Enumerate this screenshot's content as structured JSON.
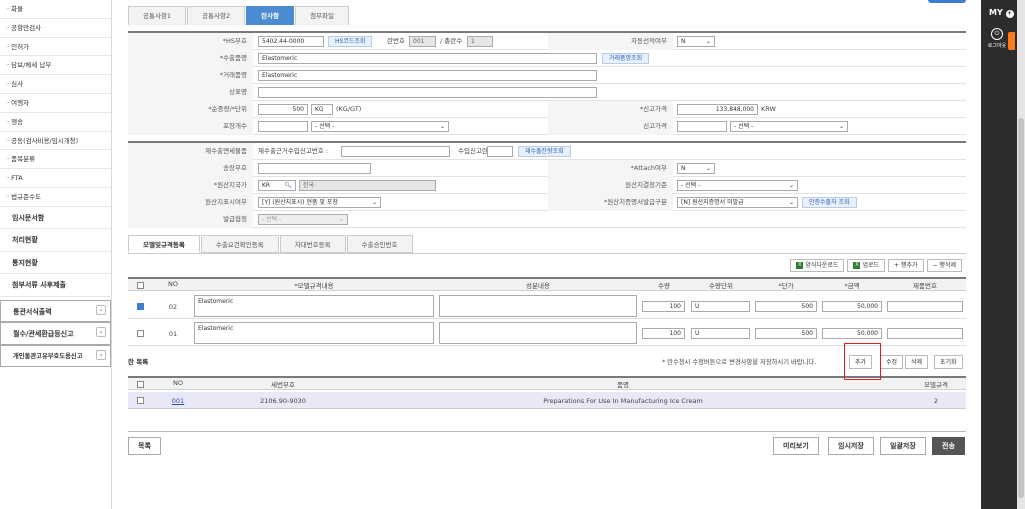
{
  "sidebar": {
    "items": [
      "화물",
      "공항만검사",
      "인허가",
      "담보/체세 납부",
      "심사",
      "여행자",
      "쟁송",
      "공동(검사비용/임시개청)",
      "품목분류",
      "FTA",
      "법규준수도"
    ],
    "top_items": [
      "임시문서함",
      "처리현황",
      "통지현황",
      "첨부서류 사후제출"
    ],
    "select_items": [
      "통관서식출력",
      "월수/관세환급등신고",
      "개인통관고유부호도용신고"
    ]
  },
  "tabs": [
    "공통사항1",
    "공통사항2",
    "란사항",
    "첨부파일"
  ],
  "form": {
    "hs_label": "*HS부호",
    "hs_value": "5402.44-0000",
    "hs_lookup": "HS코드조회",
    "ran_label": "란번호",
    "ran_value": "001",
    "total_ran_label": "/ 총란수",
    "total_ran_value": "1",
    "auto_sel_label": "자동선적여부",
    "auto_sel_value": "N",
    "export_name_label": "*수출품명",
    "export_name_value": "Elastomeric",
    "trade_lookup": "거래품명조회",
    "trade_name_label": "*거래품명",
    "trade_name_value": "Elastomeric",
    "brand_label": "상표명",
    "brand_value": "",
    "weight_label": "*순중량/*단위",
    "weight_value": "500",
    "weight_unit": "KG",
    "weight_unit_text": "(KG/GT)",
    "declared_price_label": "*신고가격",
    "declared_price_value": "133,848,000",
    "currency": "KRW",
    "pack_label": "포장개수",
    "pack_select": "- 선택 -",
    "declared_amount_label": "신고가격",
    "declared_amount_select": "- 선택 -",
    "reexport_label": "재수출면세물품",
    "reexport_text": "재수출근거수입신고번호 :",
    "import_num_text": "수입신고란번호 :",
    "reexport_lookup": "재수출잔량조회",
    "song_label": "송장부호",
    "attach_label": "*Attach여부",
    "attach_value": "N",
    "origin_label": "*원산지국가",
    "origin_code": "KR",
    "origin_name": "한국",
    "origin_basis_label": "원산지결정기준",
    "origin_basis_value": "- 선택 -",
    "origin_mark_label": "원산지표시여부",
    "origin_mark_value": "[Y] (원산지표시) 현품 및 포장",
    "origin_cert_label": "*원산지증명서발급구분",
    "origin_cert_value": "[N] 원산지증명서 미발급",
    "exporter_lookup": "인증수출자 조회",
    "issue_label": "발급협정",
    "issue_value": "- 선택 -"
  },
  "subtabs": [
    "모델및규격등록",
    "수출요건확인등록",
    "자대번호등록",
    "수출승인번호"
  ],
  "toolbar": {
    "download": "양식다운로드",
    "upload": "업로드",
    "add_row": "+ 행추가",
    "del_row": "− 행삭제"
  },
  "model_table": {
    "headers": [
      "NO",
      "*모델규격내용",
      "성분내용",
      "수량",
      "수량단위",
      "*단가",
      "*금액",
      "제품번호"
    ],
    "rows": [
      {
        "no": "02",
        "spec": "Elastomeric",
        "qty": "100",
        "unit": "U",
        "price": "500",
        "amount": "50,000",
        "checked": true
      },
      {
        "no": "01",
        "spec": "Elastomeric",
        "qty": "100",
        "unit": "U",
        "price": "500",
        "amount": "50,000",
        "checked": false
      }
    ]
  },
  "ran_list": {
    "title": "란 목록",
    "note": "* 란수정시 수정버튼으로 변경사항을 저장하시기 바랍니다.",
    "buttons": [
      "추가",
      "수정",
      "삭제",
      "초기화"
    ],
    "headers": [
      "NO",
      "세번부호",
      "품명",
      "모델규격"
    ],
    "rows": [
      {
        "no": "001",
        "hs": "2106.90-9030",
        "name": "Preparations For Use In Manufacturing Ice Cream",
        "count": "2"
      }
    ]
  },
  "bottom": {
    "list": "목록",
    "preview": "미리보기",
    "temp_save": "임시저장",
    "batch_save": "일괄저장",
    "send": "전송"
  },
  "right": {
    "my": "MY",
    "logout": "로그아웃"
  },
  "colors": {
    "accent": "#4a8bd1",
    "highlight": "#e02020"
  }
}
